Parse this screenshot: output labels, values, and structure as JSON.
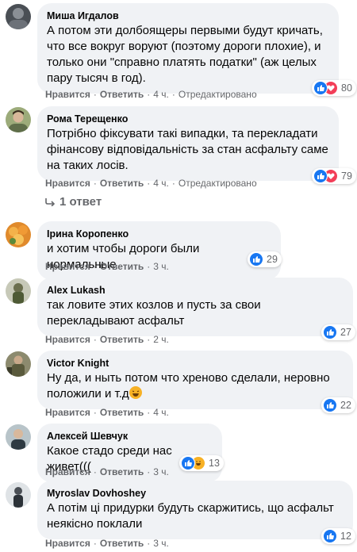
{
  "comments": [
    {
      "author": "Миша Игдалов",
      "text": "А потом эти долбоящеры первыми будут кричать, что все вокруг воруют (поэтому дороги плохие), и только они \"справно платять податки\" (аж целых пару тысяч в год).",
      "reactions": [
        "like",
        "love"
      ],
      "reaction_count": "80",
      "like_label": "Нравится",
      "reply_label": "Ответить",
      "time": "4 ч.",
      "edited": "Отредактировано"
    },
    {
      "author": "Рома Терещенко",
      "text": "Потрібно фіксувати такі випадки, та перекладати фінансову відповідальність за стан асфальту саме на таких лосів.",
      "reactions": [
        "like",
        "love"
      ],
      "reaction_count": "79",
      "like_label": "Нравится",
      "reply_label": "Ответить",
      "time": "4 ч.",
      "edited": "Отредактировано",
      "replies_link": "1 ответ"
    },
    {
      "author": "Ірина Коропенко",
      "text": "и хотим чтобы дороги были нормальные",
      "reactions": [
        "like"
      ],
      "reaction_count": "29",
      "like_label": "Нравится",
      "reply_label": "Ответить",
      "time": "3 ч."
    },
    {
      "author": "Alex Lukash",
      "text": "так ловите этих козлов и пусть за свои перекладывают асфальт",
      "reactions": [
        "like"
      ],
      "reaction_count": "27",
      "like_label": "Нравится",
      "reply_label": "Ответить",
      "time": "2 ч."
    },
    {
      "author": "Victor Knight",
      "text": "Ну да, и ныть потом что хреново сделали, неровно положили и т.д",
      "text_emoji": "laughing-emoji",
      "reactions": [
        "like"
      ],
      "reaction_count": "22",
      "like_label": "Нравится",
      "reply_label": "Ответить",
      "time": "4 ч."
    },
    {
      "author": "Алексей Шевчук",
      "text": "Какое стадо среди нас живет(((",
      "reactions": [
        "like",
        "haha"
      ],
      "reaction_count": "13",
      "like_label": "Нравится",
      "reply_label": "Ответить",
      "time": "3 ч."
    },
    {
      "author": "Myroslav Dovhoshey",
      "text": "А потім ці придурки будуть скаржитись, що асфальт неякісно поклали",
      "reactions": [
        "like"
      ],
      "reaction_count": "12",
      "like_label": "Нравится",
      "reply_label": "Ответить",
      "time": "3 ч."
    }
  ],
  "colors": {
    "bubble": "#f0f2f5",
    "secondary_text": "#65676b",
    "like": "#1877f2",
    "love": "#f33e58",
    "haha": "#f7b125"
  }
}
